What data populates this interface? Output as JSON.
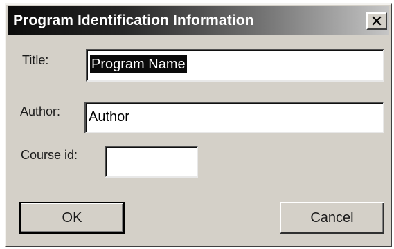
{
  "window": {
    "title": "Program Identification Information"
  },
  "icons": {
    "close": "close-icon"
  },
  "form": {
    "title_label": "Title:",
    "title_value": "Program Name",
    "author_label": "Author:",
    "author_value": "Author",
    "course_label": "Course id:",
    "course_value": ""
  },
  "buttons": {
    "ok_label": "OK",
    "cancel_label": "Cancel"
  },
  "colors": {
    "dialog_face": "#d4d0c8",
    "titlebar_start": "#0b0b0b",
    "titlebar_end": "#c6c6c6",
    "selection": "#0a0a0a"
  }
}
